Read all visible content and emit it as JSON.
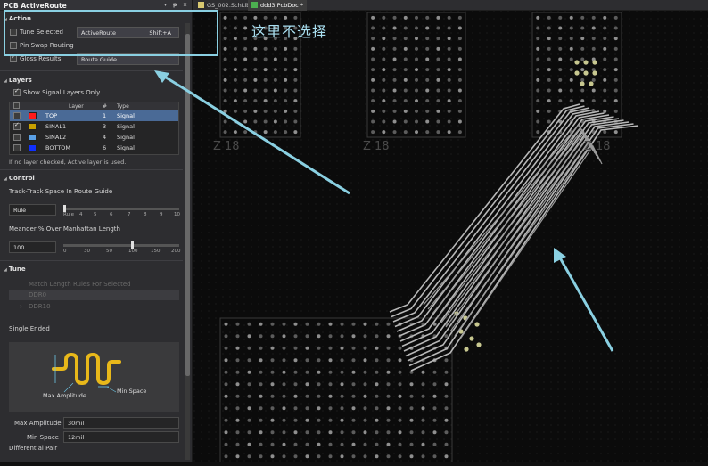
{
  "panel": {
    "title": "PCB ActiveRoute",
    "controls": [
      "▾",
      "ᵽ",
      "×"
    ],
    "action": {
      "header": "Action",
      "tune_selected": "Tune Selected",
      "pin_swap": "Pin Swap Routing",
      "gloss": "Gloss Results",
      "activeroute_btn": "ActiveRoute",
      "shortcut": "Shift+A",
      "route_guide_btn": "Route Guide"
    },
    "layers": {
      "header": "Layers",
      "show_signal": "Show Signal Layers Only",
      "col_layer": "Layer",
      "col_num": "#",
      "col_type": "Type",
      "rows": [
        {
          "name": "TOP",
          "num": "1",
          "type": "Signal",
          "color": "#ff1a1a",
          "checked": false,
          "selected": true
        },
        {
          "name": "SINAL1",
          "num": "3",
          "type": "Signal",
          "color": "#c8a000",
          "checked": true,
          "selected": false
        },
        {
          "name": "SINAL2",
          "num": "4",
          "type": "Signal",
          "color": "#5aa0e6",
          "checked": false,
          "selected": false
        },
        {
          "name": "BOTTOM",
          "num": "6",
          "type": "Signal",
          "color": "#1030ff",
          "checked": false,
          "selected": false
        }
      ],
      "note": "If no layer checked, Active layer is used."
    },
    "control": {
      "header": "Control",
      "track_label": "Track-Track Space In Route Guide",
      "track_value": "Rule",
      "track_ticks": [
        "Rule",
        "4",
        "5",
        "6",
        "7",
        "8",
        "9",
        "10"
      ],
      "meander_label": "Meander % Over Manhattan Length",
      "meander_value": "100",
      "meander_ticks": [
        "0",
        "30",
        "50",
        "100",
        "150",
        "200"
      ]
    },
    "tune": {
      "header": "Tune",
      "match_length": "Match Length Rules For Selected",
      "item1": "DDR0",
      "item2": "DDR10",
      "single_ended": "Single Ended",
      "max_amp_label": "Max Amplitude",
      "min_space_label": "Min Space",
      "max_amp_field_label": "Max Amplitude",
      "max_amp_value": "30mil",
      "min_space_field_label": "Min Space",
      "min_space_value": "12mil",
      "diff_pair": "Differential Pair"
    }
  },
  "tabs": [
    {
      "label": "GS_002.SchLib",
      "active": false
    },
    {
      "label": "ddd3.PcbDoc *",
      "active": true
    }
  ],
  "annotation": {
    "callout": "这里不选择"
  },
  "pcb_labels": [
    "Z 18",
    "Z 18",
    "Z 18"
  ]
}
